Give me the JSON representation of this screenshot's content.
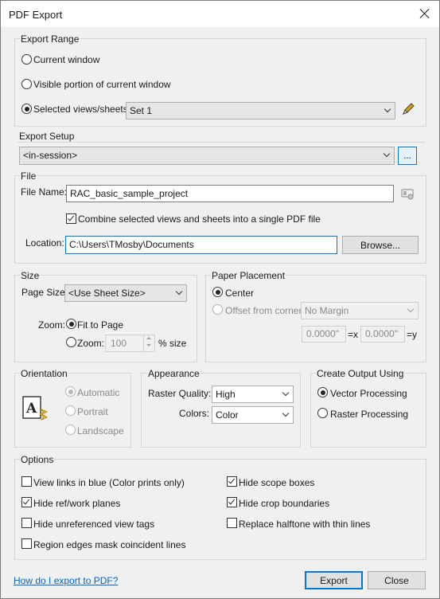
{
  "window": {
    "title": "PDF Export"
  },
  "export_range": {
    "label": "Export Range",
    "options": [
      "Current window",
      "Visible portion of current window",
      "Selected views/sheets"
    ],
    "selected_index": 2,
    "set_value": "Set 1"
  },
  "export_setup": {
    "label": "Export Setup",
    "value": "<in-session>",
    "browse_label": "..."
  },
  "file": {
    "label": "File",
    "file_name_label": "File Name:",
    "file_name_value": "RAC_basic_sample_project",
    "combine_label": "Combine selected views and sheets into a single PDF file",
    "combine_checked": true,
    "location_label": "Location:",
    "location_value": "C:\\Users\\TMosby\\Documents",
    "browse_button": "Browse..."
  },
  "size": {
    "label": "Size",
    "page_size_label": "Page Size:",
    "page_size_value": "<Use Sheet Size>",
    "zoom_label": "Zoom:",
    "fit_to_page": "Fit to Page",
    "zoom_option": "Zoom:",
    "zoom_value": "100",
    "percent_label": "% size"
  },
  "paper_placement": {
    "label": "Paper Placement",
    "center": "Center",
    "offset": "Offset from corner:",
    "margin_value": "No Margin",
    "x_value": "0.0000\"",
    "x_label": "=x",
    "y_value": "0.0000\"",
    "y_label": "=y"
  },
  "orientation": {
    "label": "Orientation",
    "options": [
      "Automatic",
      "Portrait",
      "Landscape"
    ],
    "selected_index": 0
  },
  "appearance": {
    "label": "Appearance",
    "raster_quality_label": "Raster Quality:",
    "raster_quality_value": "High",
    "colors_label": "Colors:",
    "colors_value": "Color"
  },
  "create_output": {
    "label": "Create Output Using",
    "options": [
      "Vector Processing",
      "Raster Processing"
    ],
    "selected_index": 0
  },
  "options": {
    "label": "Options",
    "items": [
      {
        "label": "View links in blue (Color prints only)",
        "checked": false
      },
      {
        "label": "Hide ref/work planes",
        "checked": true
      },
      {
        "label": "Hide unreferenced view tags",
        "checked": false
      },
      {
        "label": "Region edges mask coincident lines",
        "checked": false
      },
      {
        "label": "Hide scope boxes",
        "checked": true
      },
      {
        "label": "Hide crop boundaries",
        "checked": true
      },
      {
        "label": "Replace halftone with thin lines",
        "checked": false
      }
    ]
  },
  "footer": {
    "help_link": "How do I export to PDF?",
    "export_button": "Export",
    "close_button": "Close"
  },
  "icons": {
    "close": "close-icon",
    "pencil": "pencil-icon",
    "key": "key-icon",
    "orientation": "document-orientation-icon"
  },
  "colors": {
    "accent": "#0078d7",
    "link": "#0066cc"
  }
}
